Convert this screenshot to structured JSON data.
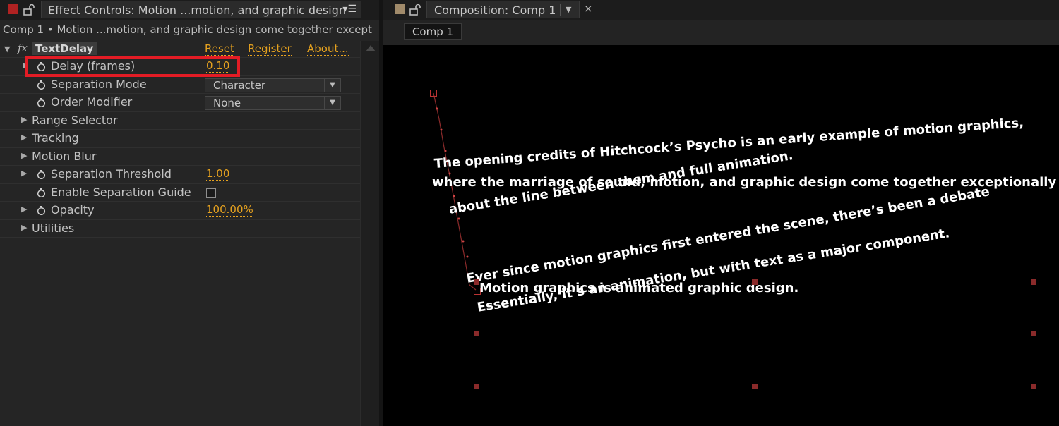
{
  "effect_panel": {
    "tab_title": "Effect Controls: Motion ...motion, and graphic design",
    "menu_glyph": "▾☰",
    "subtitle": "Comp 1 • Motion ...motion, and graphic design come together except",
    "effect": {
      "fx_symbol": "fx",
      "name": "TextDelay",
      "reset_label": "Reset",
      "register_label": "Register",
      "about_label": "About..."
    },
    "properties": [
      {
        "label": "Delay (frames)",
        "value": "0.10"
      },
      {
        "label": "Separation Mode",
        "dropdown": "Character"
      },
      {
        "label": "Order Modifier",
        "dropdown": "None"
      },
      {
        "label": "Range Selector"
      },
      {
        "label": "Tracking"
      },
      {
        "label": "Motion Blur"
      },
      {
        "label": "Separation Threshold",
        "value": "1.00"
      },
      {
        "label": "Enable Separation Guide",
        "checkbox": false
      },
      {
        "label": "Opacity",
        "value": "100.00%"
      },
      {
        "label": "Utilities"
      }
    ]
  },
  "composition_panel": {
    "tab_title": "Composition: Comp 1",
    "close_glyph": "×",
    "comp_chip": "Comp 1",
    "canvas_text": [
      "The opening credits of Hitchcock’s Psycho is an early example of motion graphics,",
      "where the marriage of sound, motion, and graphic design come together exceptionally well.",
      "about the line between them and full animation.",
      "Ever since motion graphics first entered the scene, there’s been a debate",
      "Motion graphics is animated graphic design.",
      "Essentially, it’s an animation, but with text as a major component."
    ]
  },
  "colors": {
    "accent_orange": "#e6a21f",
    "highlight_red": "#e31c25",
    "handle_red": "#8a2a2a"
  }
}
